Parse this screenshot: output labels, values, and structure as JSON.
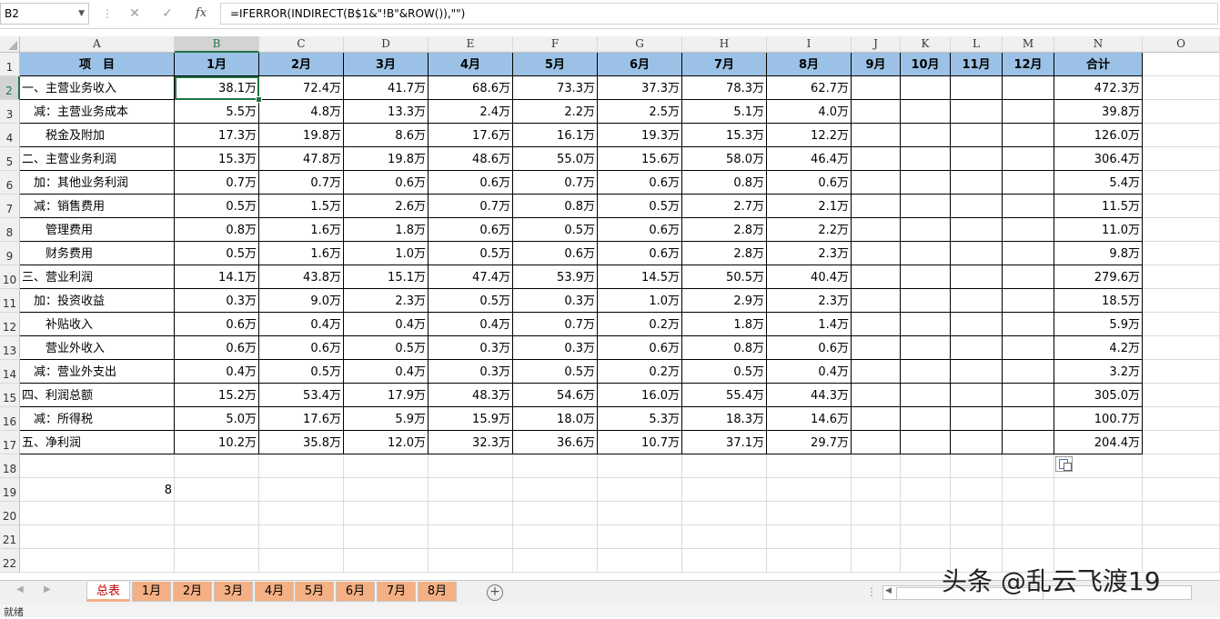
{
  "formula_bar": {
    "name_box": "B2",
    "formula": "=IFERROR(INDIRECT(B$1&\"!B\"&ROW()),\"\")",
    "cancel_icon": "close-icon",
    "enter_icon": "check-icon",
    "fx_label": "fx"
  },
  "columns": [
    "A",
    "B",
    "C",
    "D",
    "E",
    "F",
    "G",
    "H",
    "I",
    "J",
    "K",
    "L",
    "M",
    "N",
    "O"
  ],
  "row_numbers": [
    "1",
    "2",
    "3",
    "4",
    "5",
    "6",
    "7",
    "8",
    "9",
    "10",
    "11",
    "12",
    "13",
    "14",
    "15",
    "16",
    "17",
    "18",
    "19",
    "20",
    "21",
    "22"
  ],
  "header_row": [
    "项　目",
    "1月",
    "2月",
    "3月",
    "4月",
    "5月",
    "6月",
    "7月",
    "8月",
    "9月",
    "10月",
    "11月",
    "12月",
    "合计"
  ],
  "table_rows": [
    {
      "label": "一、主营业务收入",
      "values": [
        "38.1万",
        "72.4万",
        "41.7万",
        "68.6万",
        "73.3万",
        "37.3万",
        "78.3万",
        "62.7万",
        "",
        "",
        "",
        "",
        "472.3万"
      ]
    },
    {
      "label": "　减：主营业务成本",
      "values": [
        "5.5万",
        "4.8万",
        "13.3万",
        "2.4万",
        "2.2万",
        "2.5万",
        "5.1万",
        "4.0万",
        "",
        "",
        "",
        "",
        "39.8万"
      ]
    },
    {
      "label": "　　税金及附加",
      "values": [
        "17.3万",
        "19.8万",
        "8.6万",
        "17.6万",
        "16.1万",
        "19.3万",
        "15.3万",
        "12.2万",
        "",
        "",
        "",
        "",
        "126.0万"
      ]
    },
    {
      "label": "二、主营业务利润",
      "values": [
        "15.3万",
        "47.8万",
        "19.8万",
        "48.6万",
        "55.0万",
        "15.6万",
        "58.0万",
        "46.4万",
        "",
        "",
        "",
        "",
        "306.4万"
      ]
    },
    {
      "label": "　加：其他业务利润",
      "values": [
        "0.7万",
        "0.7万",
        "0.6万",
        "0.6万",
        "0.7万",
        "0.6万",
        "0.8万",
        "0.6万",
        "",
        "",
        "",
        "",
        "5.4万"
      ]
    },
    {
      "label": "　减：销售费用",
      "values": [
        "0.5万",
        "1.5万",
        "2.6万",
        "0.7万",
        "0.8万",
        "0.5万",
        "2.7万",
        "2.1万",
        "",
        "",
        "",
        "",
        "11.5万"
      ]
    },
    {
      "label": "　　管理费用",
      "values": [
        "0.8万",
        "1.6万",
        "1.8万",
        "0.6万",
        "0.5万",
        "0.6万",
        "2.8万",
        "2.2万",
        "",
        "",
        "",
        "",
        "11.0万"
      ]
    },
    {
      "label": "　　财务费用",
      "values": [
        "0.5万",
        "1.6万",
        "1.0万",
        "0.5万",
        "0.6万",
        "0.6万",
        "2.8万",
        "2.3万",
        "",
        "",
        "",
        "",
        "9.8万"
      ]
    },
    {
      "label": "三、营业利润",
      "values": [
        "14.1万",
        "43.8万",
        "15.1万",
        "47.4万",
        "53.9万",
        "14.5万",
        "50.5万",
        "40.4万",
        "",
        "",
        "",
        "",
        "279.6万"
      ]
    },
    {
      "label": "　加：投资收益",
      "values": [
        "0.3万",
        "9.0万",
        "2.3万",
        "0.5万",
        "0.3万",
        "1.0万",
        "2.9万",
        "2.3万",
        "",
        "",
        "",
        "",
        "18.5万"
      ]
    },
    {
      "label": "　　补贴收入",
      "values": [
        "0.6万",
        "0.4万",
        "0.4万",
        "0.4万",
        "0.7万",
        "0.2万",
        "1.8万",
        "1.4万",
        "",
        "",
        "",
        "",
        "5.9万"
      ]
    },
    {
      "label": "　　营业外收入",
      "values": [
        "0.6万",
        "0.6万",
        "0.5万",
        "0.3万",
        "0.3万",
        "0.6万",
        "0.8万",
        "0.6万",
        "",
        "",
        "",
        "",
        "4.2万"
      ]
    },
    {
      "label": "　减：营业外支出",
      "values": [
        "0.4万",
        "0.5万",
        "0.4万",
        "0.3万",
        "0.5万",
        "0.2万",
        "0.5万",
        "0.4万",
        "",
        "",
        "",
        "",
        "3.2万"
      ]
    },
    {
      "label": "四、利润总额",
      "values": [
        "15.2万",
        "53.4万",
        "17.9万",
        "48.3万",
        "54.6万",
        "16.0万",
        "55.4万",
        "44.3万",
        "",
        "",
        "",
        "",
        "305.0万"
      ]
    },
    {
      "label": "　减：所得税",
      "values": [
        "5.0万",
        "17.6万",
        "5.9万",
        "15.9万",
        "18.0万",
        "5.3万",
        "18.3万",
        "14.6万",
        "",
        "",
        "",
        "",
        "100.7万"
      ]
    },
    {
      "label": "五、净利润",
      "values": [
        "10.2万",
        "35.8万",
        "12.0万",
        "32.3万",
        "36.6万",
        "10.7万",
        "37.1万",
        "29.7万",
        "",
        "",
        "",
        "",
        "204.4万"
      ]
    }
  ],
  "a19_value": "8",
  "sheet_tabs": [
    "总表",
    "1月",
    "2月",
    "3月",
    "4月",
    "5月",
    "6月",
    "7月",
    "8月"
  ],
  "active_sheet": "总表",
  "status_text": "就绪",
  "watermark": "头条 @乱云飞渡19",
  "colors": {
    "header_fill": "#9bc2e6",
    "tab_fill": "#f4b084",
    "active_tab_text": "#c00000",
    "selection": "#217346"
  }
}
